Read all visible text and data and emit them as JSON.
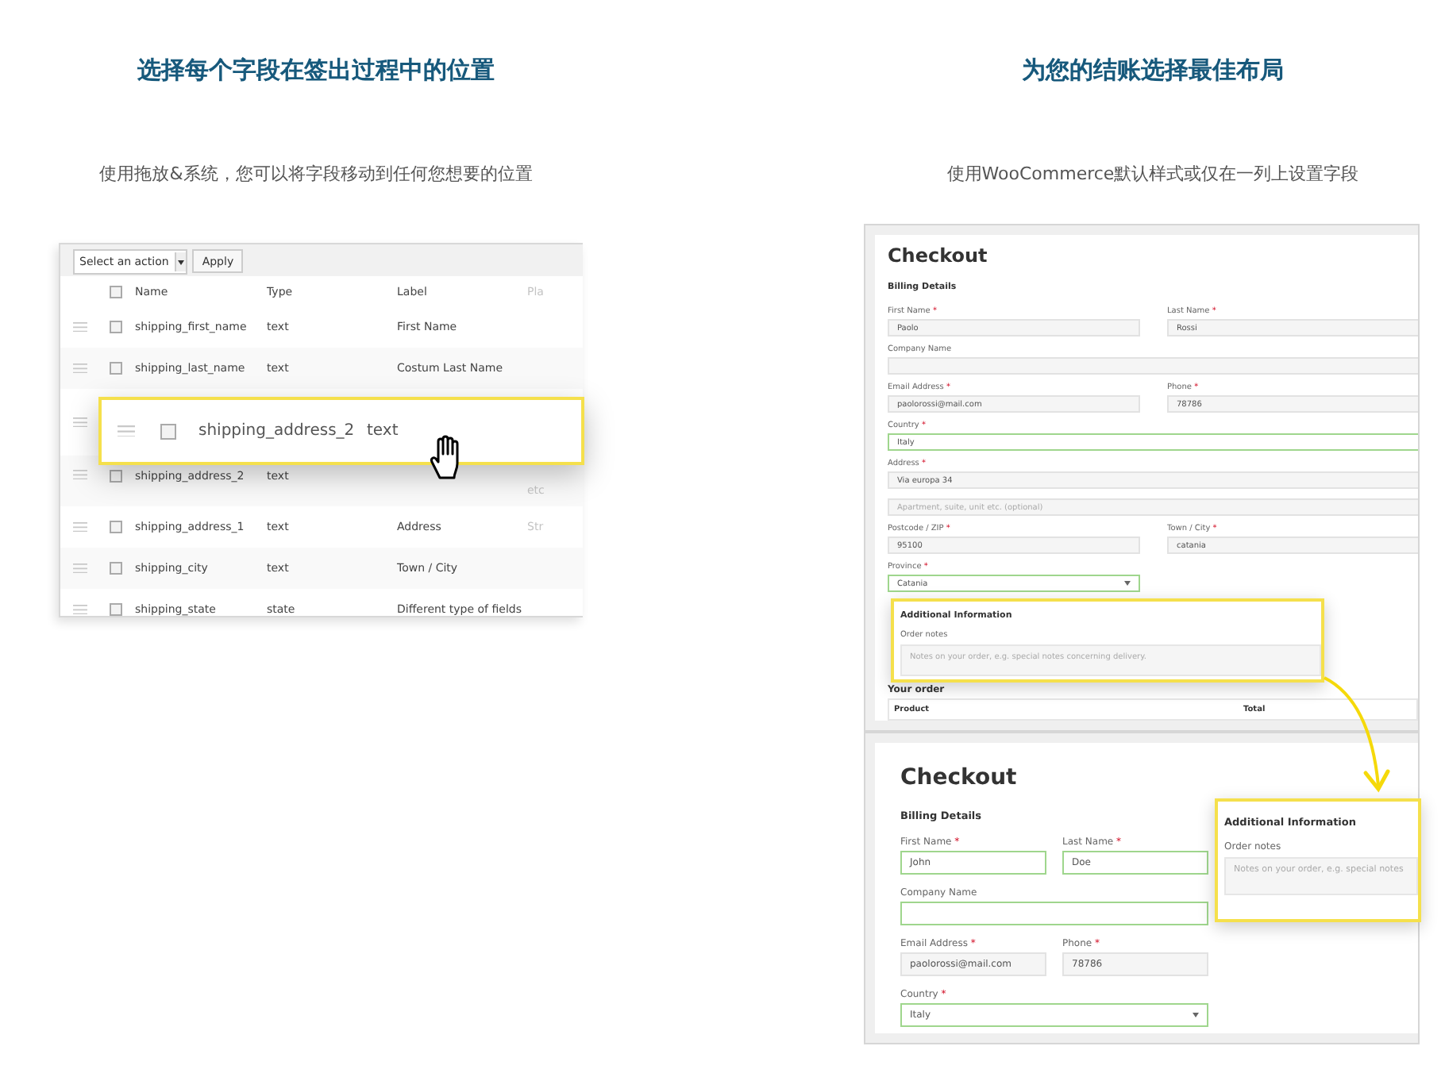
{
  "left": {
    "title": "选择每个字段在签出过程中的位置",
    "subtitle": "使用拖放&系统，您可以将字段移动到任何您想要的位置",
    "table": {
      "bulk_action": "Select an action",
      "apply": "Apply",
      "header_checked": false,
      "columns": [
        "Name",
        "Type",
        "Label",
        "Pla"
      ],
      "rows": [
        {
          "kind": "field",
          "name": "shipping_first_name",
          "type": "text",
          "label": "First Name",
          "column_4": "",
          "checked": false
        },
        {
          "kind": "field",
          "name": "shipping_last_name",
          "type": "text",
          "label": "Costum Last Name",
          "column_4": "",
          "checked": false
        },
        {
          "kind": "placeholder"
        },
        {
          "kind": "field",
          "name": "shipping_address_2",
          "type": "text",
          "label": "",
          "column_4": "etc",
          "checked": false
        },
        {
          "kind": "field",
          "name": "shipping_address_1",
          "type": "text",
          "label": "Address",
          "column_4": "Str",
          "checked": false
        },
        {
          "kind": "field",
          "name": "shipping_city",
          "type": "text",
          "label": "Town / City",
          "column_4": "",
          "checked": false
        },
        {
          "kind": "field",
          "name": "shipping_state",
          "type": "state",
          "label": "Different type of fields",
          "column_4": "",
          "checked": false
        }
      ],
      "dragged_row": {
        "name": "shipping_address_2",
        "type": "text",
        "checked": false
      }
    }
  },
  "right": {
    "title": "为您的结账选择最佳布局",
    "subtitle": "使用WooCommerce默认样式或仅在一列上设置字段",
    "top_form": {
      "title": "Checkout",
      "section": "Billing Details",
      "rows": [
        [
          {
            "kind": "input",
            "label": "First Name",
            "required_mark": "*",
            "value": "Paolo",
            "valid": false
          },
          {
            "kind": "input",
            "label": "Last Name",
            "required_mark": "*",
            "value": "Rossi",
            "valid": false
          }
        ],
        [
          {
            "kind": "input",
            "label": "Company Name",
            "valid": false
          }
        ],
        [
          {
            "kind": "input",
            "label": "Email Address",
            "required_mark": "*",
            "value": "paolorossi@mail.com",
            "valid": false
          },
          {
            "kind": "input",
            "label": "Phone",
            "required_mark": "*",
            "value": "78786",
            "valid": false
          }
        ],
        [
          {
            "kind": "input",
            "label": "Country",
            "required_mark": "*",
            "value": "Italy",
            "valid": true
          }
        ],
        [
          {
            "kind": "input",
            "label": "Address",
            "required_mark": "*",
            "value": "Via europa 34",
            "valid": false
          }
        ],
        [
          {
            "kind": "input",
            "placeholder": "Apartment, suite, unit etc. (optional)",
            "valid": false
          }
        ],
        [
          {
            "kind": "input",
            "label": "Postcode / ZIP",
            "required_mark": "*",
            "value": "95100",
            "valid": false
          },
          {
            "kind": "input",
            "label": "Town / City",
            "required_mark": "*",
            "value": "catania",
            "valid": false
          }
        ],
        [
          {
            "kind": "select",
            "label": "Province",
            "required_mark": "*",
            "value": "Catania",
            "valid": true
          },
          null
        ]
      ],
      "additional": {
        "title": "Additional Information",
        "label": "Order notes",
        "placeholder": "Notes on your order, e.g. special notes concerning delivery."
      },
      "order_title": "Your order",
      "order_columns": [
        "Product",
        "Total"
      ]
    },
    "bottom_form": {
      "title": "Checkout",
      "section": "Billing Details",
      "rows": [
        [
          {
            "kind": "input",
            "label": "First Name",
            "required_mark": "*",
            "value": "John",
            "valid": true
          },
          {
            "kind": "input",
            "label": "Last Name",
            "required_mark": "*",
            "value": "Doe",
            "valid": true
          }
        ],
        [
          {
            "kind": "input",
            "label": "Company Name",
            "valid": true
          }
        ],
        [
          {
            "kind": "input",
            "label": "Email Address",
            "required_mark": "*",
            "value": "paolorossi@mail.com",
            "valid": false
          },
          {
            "kind": "input",
            "label": "Phone",
            "required_mark": "*",
            "value": "78786",
            "valid": false
          }
        ],
        [
          {
            "kind": "select",
            "label": "Country",
            "required_mark": "*",
            "value": "Italy",
            "valid": true
          }
        ]
      ],
      "additional": {
        "title": "Additional Information",
        "label": "Order notes",
        "placeholder": "Notes on your order, e.g. special notes"
      }
    }
  }
}
